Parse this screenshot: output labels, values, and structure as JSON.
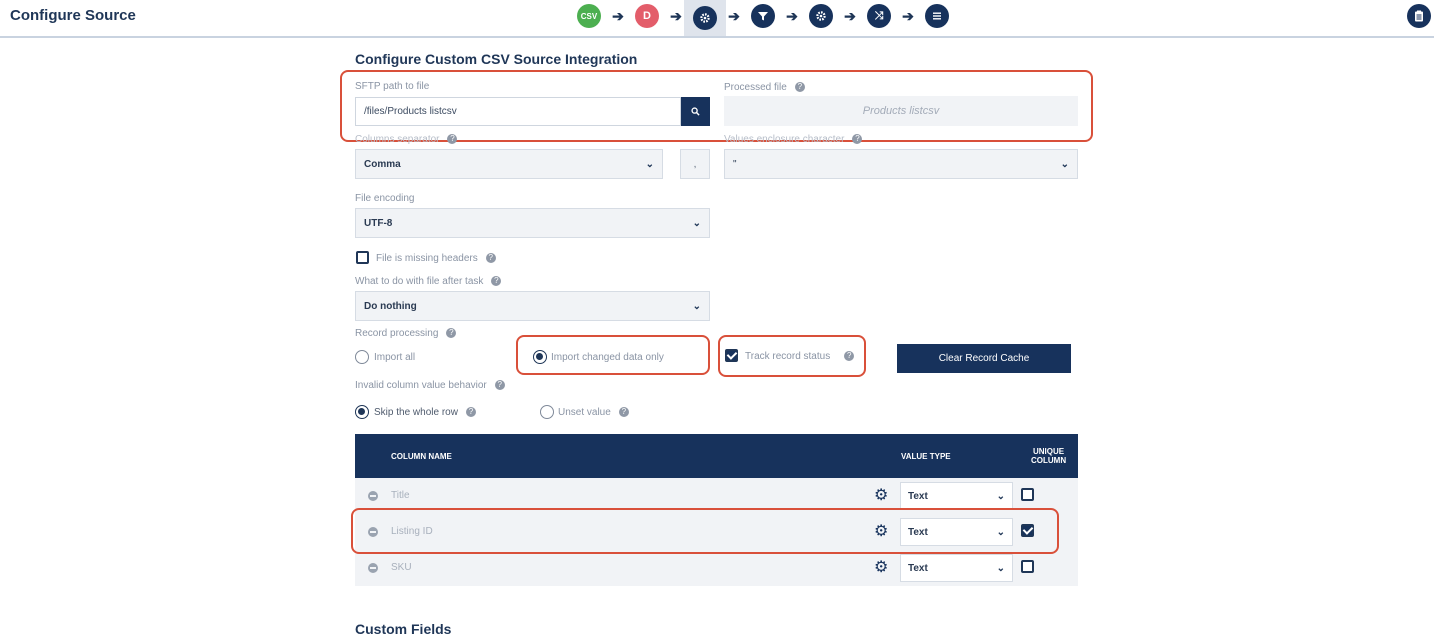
{
  "app": {
    "title": "Configure Source"
  },
  "steps": [
    {
      "id": "csv",
      "label": "CSV",
      "icon": "csv-badge"
    },
    {
      "id": "d",
      "label": "D",
      "icon": "d-badge"
    },
    {
      "id": "settings",
      "label": "",
      "icon": "gear-icon"
    },
    {
      "id": "filter",
      "label": "",
      "icon": "filter-icon"
    },
    {
      "id": "settings2",
      "label": "",
      "icon": "gear-icon"
    },
    {
      "id": "shuffle",
      "label": "",
      "icon": "shuffle-icon"
    },
    {
      "id": "list",
      "label": "",
      "icon": "list-icon"
    }
  ],
  "form": {
    "heading": "Configure Custom CSV Source Integration",
    "sftp_label": "SFTP path to file",
    "sftp_value": "/files/Products listcsv",
    "processed_label": "Processed file",
    "processed_value": "Products listcsv",
    "separator_label": "Columns separator",
    "separator_value": "Comma",
    "separator_char": ",",
    "enclosure_label": "Values enclosure character",
    "enclosure_value": "\"",
    "encoding_label": "File encoding",
    "encoding_value": "UTF-8",
    "missing_headers_label": "File is missing headers",
    "after_task_label": "What to do with file after task",
    "after_task_value": "Do nothing",
    "record_processing_label": "Record processing",
    "import_all_label": "Import all",
    "import_changed_label": "Import changed data only",
    "track_status_label": "Track record status",
    "clear_cache_label": "Clear Record Cache",
    "invalid_behavior_label": "Invalid column value behavior",
    "skip_row_label": "Skip the whole row",
    "unset_value_label": "Unset value"
  },
  "table": {
    "headers": {
      "column_name": "COLUMN NAME",
      "value_type": "VALUE TYPE",
      "unique_l1": "UNIQUE",
      "unique_l2": "COLUMN"
    },
    "rows": [
      {
        "name": "Title",
        "type": "Text",
        "unique": false
      },
      {
        "name": "Listing ID",
        "type": "Text",
        "unique": true
      },
      {
        "name": "SKU",
        "type": "Text",
        "unique": false
      }
    ]
  },
  "custom_fields": {
    "title": "Custom Fields"
  },
  "colors": {
    "navy": "#17325c",
    "highlight": "#d9503a",
    "csv_green": "#4caf50",
    "d_red": "#e35d6a"
  }
}
